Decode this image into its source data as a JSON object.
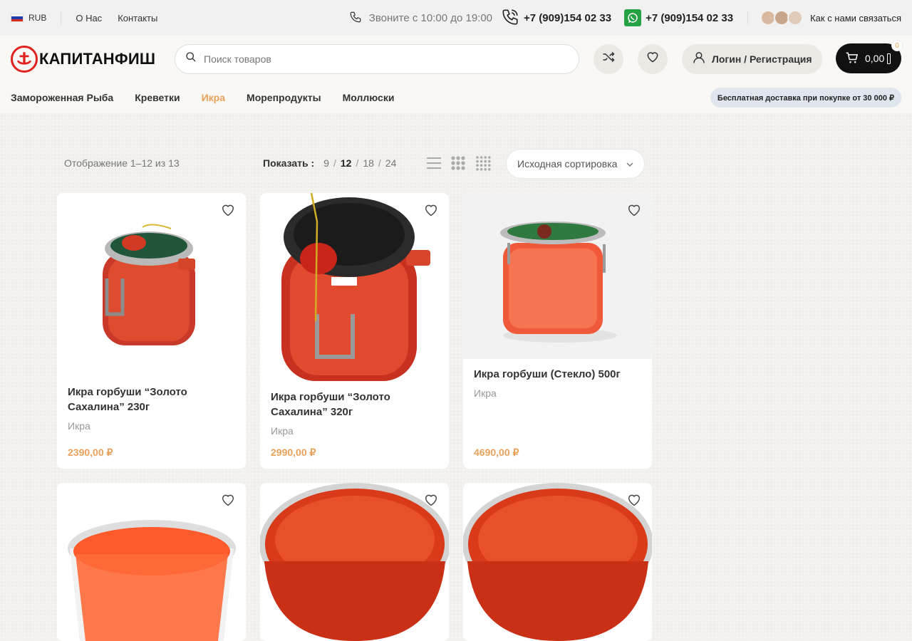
{
  "topbar": {
    "currency": "RUB",
    "links": [
      "О Нас",
      "Контакты"
    ],
    "call_note": "Звоните с 10:00 до 19:00",
    "phone1": "+7 (909)154 02 33",
    "phone2": "+7 (909)154 02 33",
    "contact_link": "Как с нами связаться"
  },
  "header": {
    "logo_text": "КАПИТАНФИШ",
    "search_placeholder": "Поиск товаров",
    "login_label": "Логин / Регистрация",
    "cart_total": "0,00",
    "cart_count": "0"
  },
  "nav": {
    "items": [
      "Замороженная Рыба",
      "Креветки",
      "Икра",
      "Морепродукты",
      "Моллюски"
    ],
    "active": "Икра",
    "shipping_badge": "Бесплатная доставка при покупке от 30 000 ₽"
  },
  "toolbar": {
    "result_count": "Отображение 1–12 из 13",
    "show_label": "Показать :",
    "per_page_options": [
      "9",
      "12",
      "18",
      "24"
    ],
    "per_page_current": "12",
    "sort_value": "Исходная сортировка"
  },
  "products": [
    {
      "title": "Икра горбуши “Золото Сахалина” 230г",
      "category": "Икра",
      "price": "2390,00 ₽"
    },
    {
      "title": "Икра горбуши “Золото Сахалина” 320г",
      "category": "Икра",
      "price": "2990,00 ₽"
    },
    {
      "title": "Икра горбуши (Стекло) 500г",
      "category": "Икра",
      "price": "4690,00 ₽"
    },
    {
      "title": "",
      "category": "",
      "price": ""
    },
    {
      "title": "",
      "category": "",
      "price": ""
    },
    {
      "title": "",
      "category": "",
      "price": ""
    }
  ],
  "colors": {
    "accent": "#e8a15a",
    "brand_red": "#e0211d",
    "caviar": "#e2452a",
    "whatsapp": "#25a244"
  }
}
